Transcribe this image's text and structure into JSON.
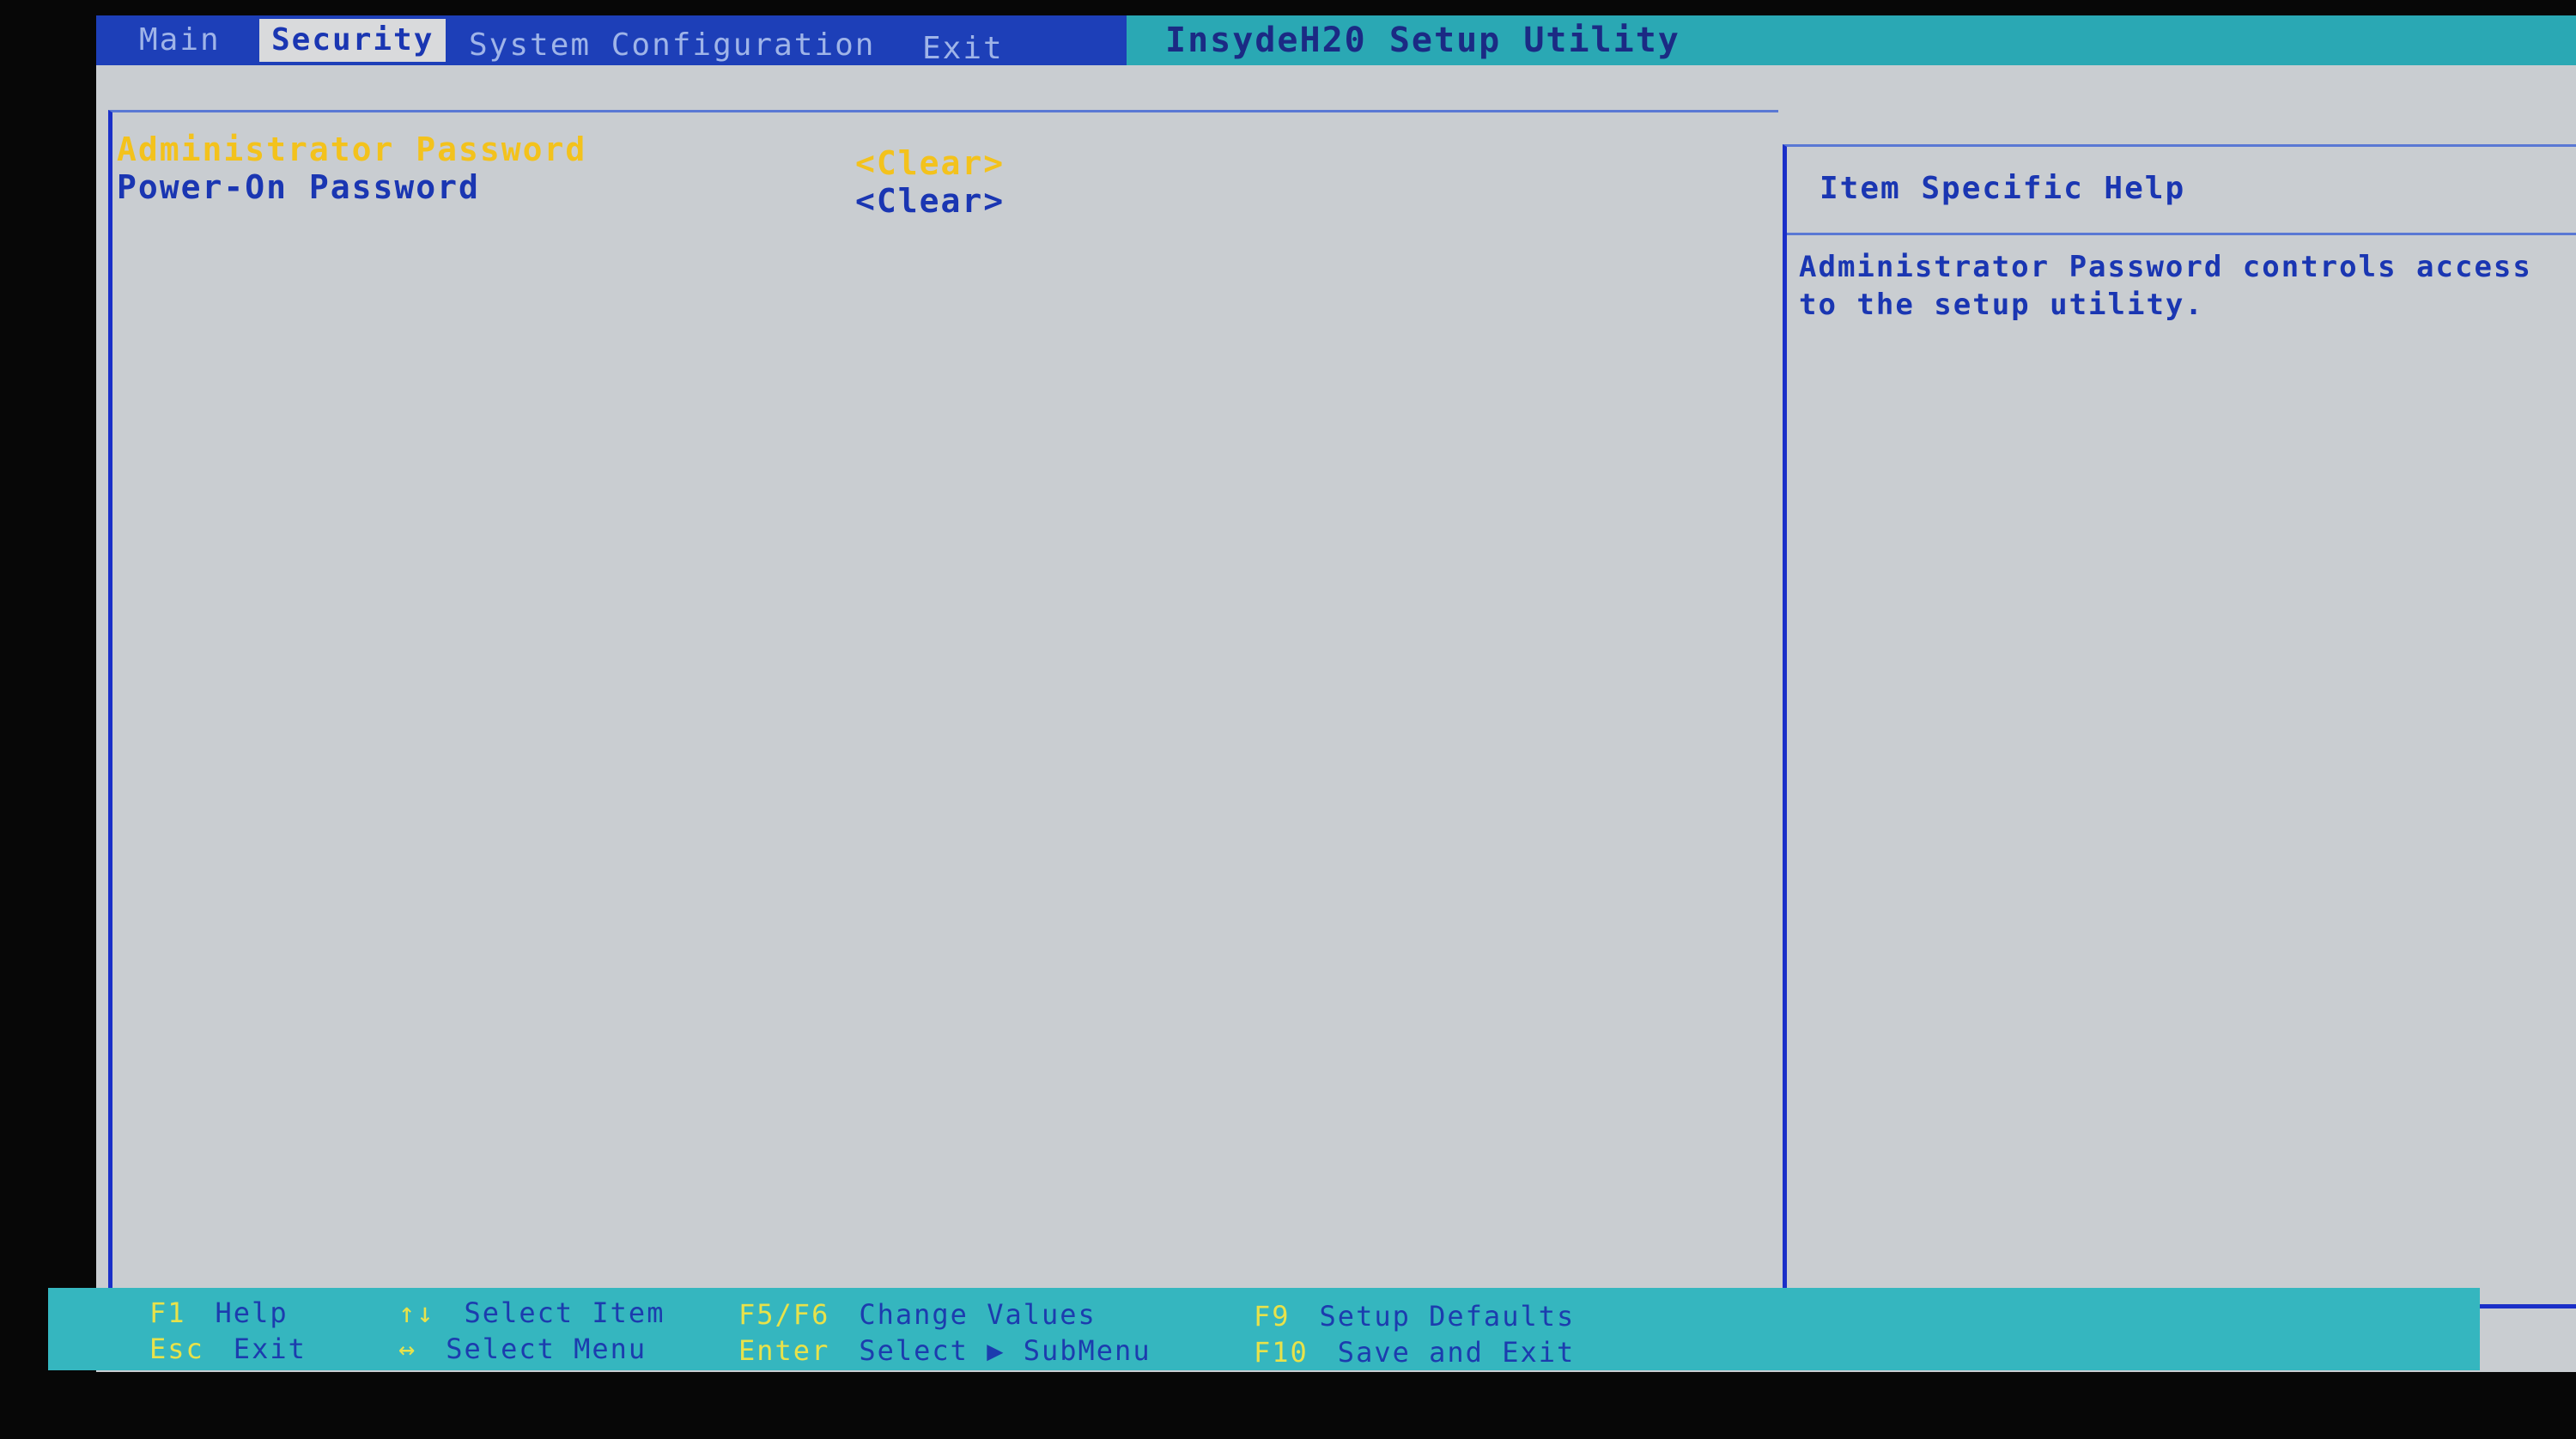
{
  "menu": {
    "tabs": [
      {
        "label": "Main"
      },
      {
        "label": "Security"
      },
      {
        "label": "System Configuration"
      },
      {
        "label": "Exit"
      }
    ],
    "active": "Security"
  },
  "app_title": "InsydeH20 Setup Utility",
  "items": [
    {
      "label": "Administrator Password",
      "value": "<Clear>"
    },
    {
      "label": "Power-On Password",
      "value": "<Clear>"
    }
  ],
  "help": {
    "title": "Item Specific Help",
    "text": "Administrator Password controls access to the setup utility."
  },
  "footer": {
    "keys": [
      {
        "key": "F1",
        "desc": "Help"
      },
      {
        "key": "Esc",
        "desc": "Exit"
      },
      {
        "key": "↑↓",
        "desc": "Select Item"
      },
      {
        "key": "↔",
        "desc": "Select Menu"
      },
      {
        "key": "F5/F6",
        "desc": "Change Values"
      },
      {
        "key": "Enter",
        "desc": "Select ▶ SubMenu"
      },
      {
        "key": "F9",
        "desc": "Setup Defaults"
      },
      {
        "key": "F10",
        "desc": "Save and Exit"
      }
    ]
  },
  "colors": {
    "background": "#c9cdd1",
    "accent_blue": "#1a36b2",
    "highlight_yellow": "#f3c21c",
    "title_bar": "#1d3fb8",
    "footer_bar": "#35b6bf"
  }
}
